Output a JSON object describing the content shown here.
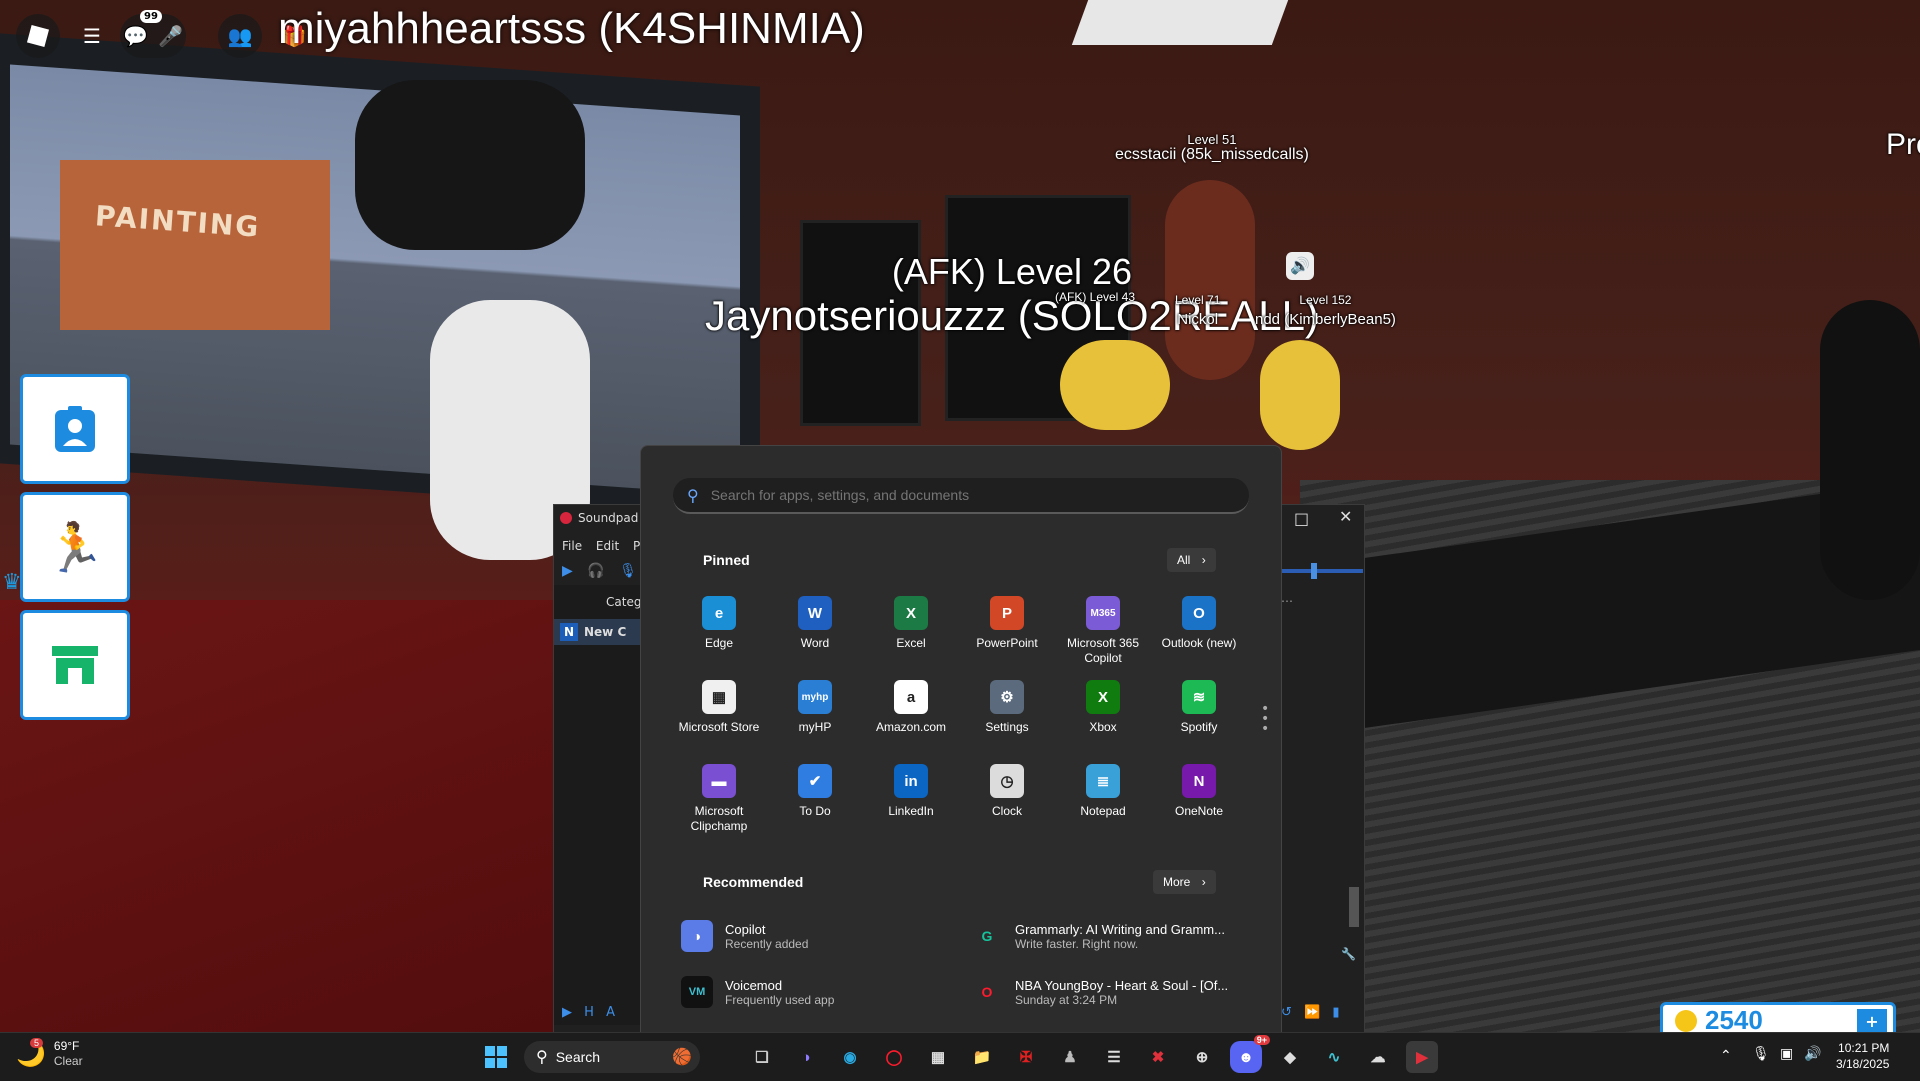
{
  "game": {
    "player_title": "miyahhheartsss (K4SHINMIA)",
    "chat_badge": "99",
    "painting_sign": "PAINTING",
    "nameplates": [
      {
        "top": "Level 51",
        "name": "ecsstacii (85k_missedcalls)"
      },
      {
        "top": "(AFK) Level 26",
        "name": "Jaynotseriouzzz (SOLO2REALL)"
      },
      {
        "top": "(AFK) Level 43",
        "name": ""
      },
      {
        "top": "Level 71",
        "name": "Nickol"
      },
      {
        "top": "Level 152",
        "name": "ndd (KimberlyBean5)"
      }
    ],
    "edge_text": "Pro",
    "coins": "2540"
  },
  "soundpad": {
    "title": "Soundpad",
    "menu": [
      "File",
      "Edit",
      "Play"
    ],
    "column_header": "Categ",
    "row_label": "New C"
  },
  "start_menu": {
    "search_placeholder": "Search for apps, settings, and documents",
    "pinned_title": "Pinned",
    "all_label": "All",
    "pinned": [
      {
        "label": "Edge",
        "icon": "edge-icon",
        "color": "#1a8fd6",
        "glyph": "e"
      },
      {
        "label": "Word",
        "icon": "word-icon",
        "color": "#1f5fbf",
        "glyph": "W"
      },
      {
        "label": "Excel",
        "icon": "excel-icon",
        "color": "#1c7a45",
        "glyph": "X"
      },
      {
        "label": "PowerPoint",
        "icon": "powerpoint-icon",
        "color": "#d24726",
        "glyph": "P"
      },
      {
        "label": "Microsoft 365 Copilot",
        "icon": "m365-copilot-icon",
        "color": "#7c5cd6",
        "glyph": "M365"
      },
      {
        "label": "Outlook (new)",
        "icon": "outlook-icon",
        "color": "#1a73c7",
        "glyph": "O"
      },
      {
        "label": "Microsoft Store",
        "icon": "store-icon",
        "color": "#f0f0f0",
        "glyph": "▦"
      },
      {
        "label": "myHP",
        "icon": "myhp-icon",
        "color": "#2a7fd4",
        "glyph": "myhp"
      },
      {
        "label": "Amazon.com",
        "icon": "amazon-icon",
        "color": "#ffffff",
        "glyph": "a"
      },
      {
        "label": "Settings",
        "icon": "settings-gear-icon",
        "color": "#5b6b7d",
        "glyph": "⚙"
      },
      {
        "label": "Xbox",
        "icon": "xbox-icon",
        "color": "#107c10",
        "glyph": "X"
      },
      {
        "label": "Spotify",
        "icon": "spotify-icon",
        "color": "#1db954",
        "glyph": "≋"
      },
      {
        "label": "Microsoft Clipchamp",
        "icon": "clipchamp-icon",
        "color": "#7b4fd1",
        "glyph": "▬"
      },
      {
        "label": "To Do",
        "icon": "todo-icon",
        "color": "#2f7de1",
        "glyph": "✔"
      },
      {
        "label": "LinkedIn",
        "icon": "linkedin-icon",
        "color": "#0a66c2",
        "glyph": "in"
      },
      {
        "label": "Clock",
        "icon": "clock-icon",
        "color": "#dcdcdc",
        "glyph": "◷"
      },
      {
        "label": "Notepad",
        "icon": "notepad-icon",
        "color": "#3aa0d8",
        "glyph": "≣"
      },
      {
        "label": "OneNote",
        "icon": "onenote-icon",
        "color": "#7719aa",
        "glyph": "N"
      }
    ],
    "recommended_title": "Recommended",
    "more_label": "More",
    "recommended": [
      {
        "title": "Copilot",
        "subtitle": "Recently added",
        "icon": "copilot-icon",
        "color": "#5b7be6",
        "glyph": "◑"
      },
      {
        "title": "Grammarly: AI Writing and Gramm...",
        "subtitle": "Write faster. Right now.",
        "icon": "grammarly-icon",
        "color": "#2c2c2c",
        "glyph": "G"
      },
      {
        "title": "Voicemod",
        "subtitle": "Frequently used app",
        "icon": "voicemod-icon",
        "color": "#111111",
        "glyph": "VM"
      },
      {
        "title": "NBA YoungBoy - Heart & Soul - [Of...",
        "subtitle": "Sunday at 3:24 PM",
        "icon": "opera-icon",
        "color": "#2c2c2c",
        "glyph": "O"
      }
    ]
  },
  "taskbar": {
    "weather_temp": "69°F",
    "weather_desc": "Clear",
    "weather_badge": "5",
    "search_label": "Search",
    "discord_badge": "9+",
    "time": "10:21 PM",
    "date": "3/18/2025"
  }
}
